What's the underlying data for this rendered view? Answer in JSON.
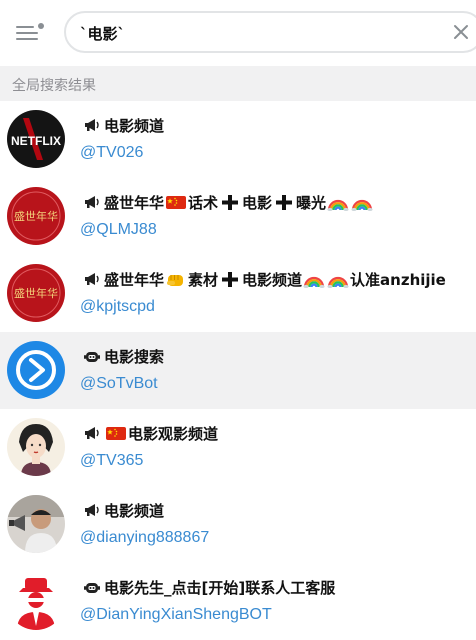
{
  "search": {
    "query": "`电影`"
  },
  "section": {
    "title": "全局搜索结果"
  },
  "icons": {
    "menu": "menu-icon",
    "clear": "close-icon",
    "channel": "megaphone-icon",
    "bot": "bot-icon"
  },
  "colors": {
    "handle": "#3a8bd1",
    "section_bg": "#f1f1f2",
    "highlight_bg": "#f1f1f2"
  },
  "results": [
    {
      "kind": "channel",
      "title": [
        "电影频道"
      ],
      "handle": "@TV026",
      "avatar": "netflix-logo"
    },
    {
      "kind": "channel",
      "title": [
        "盛世年华",
        "flag-cn",
        "话术",
        "plus",
        "电影",
        "plus",
        "曝光",
        "rainbow",
        "rainbow"
      ],
      "handle": "@QLMJ88",
      "avatar": "red-seal-logo"
    },
    {
      "kind": "channel",
      "title": [
        "盛世年华",
        "fist",
        "素材",
        "plus",
        "电影频道",
        "rainbow",
        "rainbow",
        "认准anzhijie"
      ],
      "handle": "@kpjtscpd",
      "avatar": "red-seal-logo"
    },
    {
      "kind": "bot",
      "title": [
        "电影搜索"
      ],
      "handle": "@SoTvBot",
      "avatar": "blue-arrow-logo",
      "highlighted": true
    },
    {
      "kind": "channel",
      "title": [
        "flag-cn",
        "电影观影频道"
      ],
      "handle": "@TV365",
      "avatar": "illustrated-woman"
    },
    {
      "kind": "channel",
      "title": [
        "电影频道"
      ],
      "handle": "@dianying888867",
      "avatar": "man-with-megaphone"
    },
    {
      "kind": "bot",
      "title": [
        "电影先生_点击[开始]联系人工客服"
      ],
      "handle": "@DianYingXianShengBOT",
      "avatar": "red-agent-logo"
    }
  ],
  "avatar_logos": {
    "netflix": "NETFLIX",
    "seal": "盛世年华"
  }
}
